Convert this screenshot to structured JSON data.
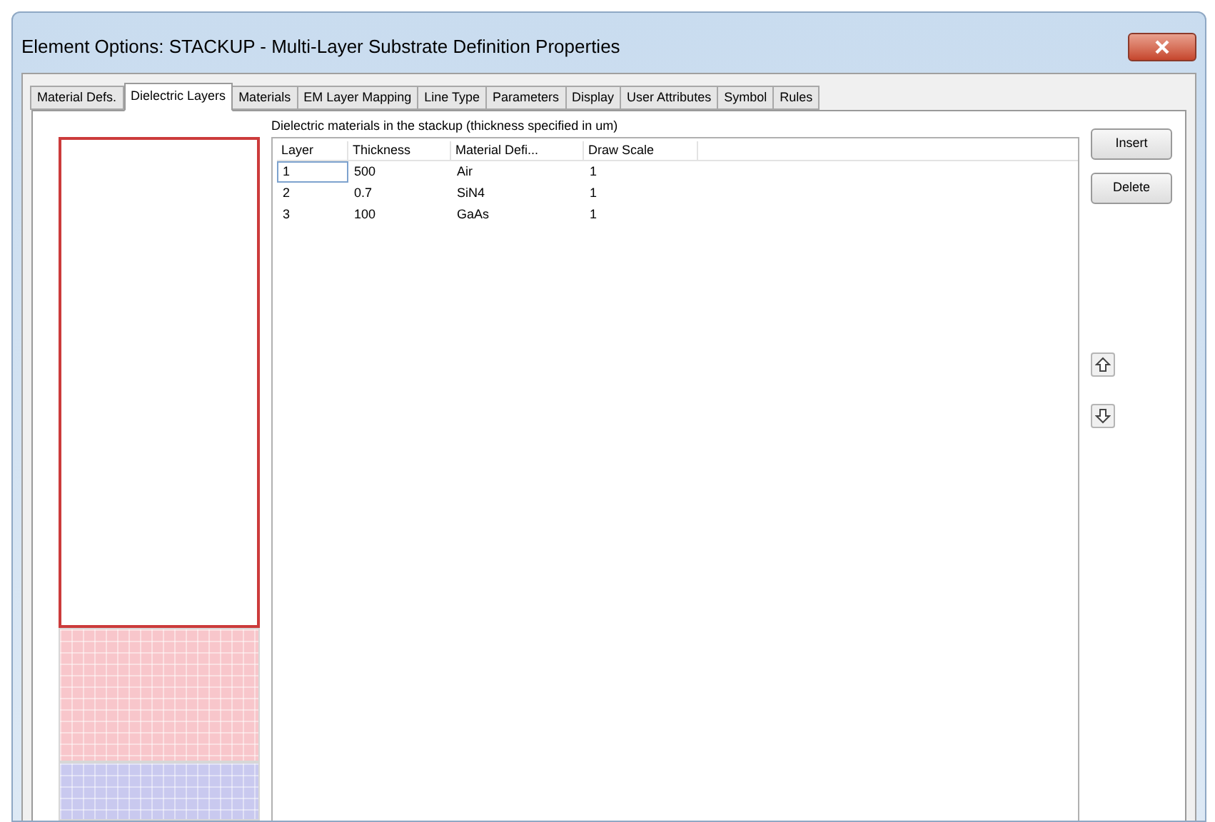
{
  "window": {
    "title": "Element Options: STACKUP - Multi-Layer Substrate Definition Properties"
  },
  "tabs": [
    {
      "label": "Material Defs.",
      "selected": false
    },
    {
      "label": "Dielectric Layers",
      "selected": true
    },
    {
      "label": "Materials",
      "selected": false
    },
    {
      "label": "EM Layer Mapping",
      "selected": false
    },
    {
      "label": "Line Type",
      "selected": false
    },
    {
      "label": "Parameters",
      "selected": false
    },
    {
      "label": "Display",
      "selected": false
    },
    {
      "label": "User Attributes",
      "selected": false
    },
    {
      "label": "Symbol",
      "selected": false
    },
    {
      "label": "Rules",
      "selected": false
    }
  ],
  "table": {
    "caption": "Dielectric materials in the stackup (thickness specified in um)",
    "columns": [
      "Layer",
      "Thickness",
      "Material Defi...",
      "Draw Scale"
    ],
    "rows": [
      {
        "cells": [
          "1",
          "500",
          "Air",
          "1"
        ],
        "selected": true,
        "color": "#ffffff"
      },
      {
        "cells": [
          "2",
          "0.7",
          "SiN4",
          "1"
        ],
        "selected": false,
        "color": "#f8c6cb"
      },
      {
        "cells": [
          "3",
          "100",
          "GaAs",
          "1"
        ],
        "selected": false,
        "color": "#c9c9ef"
      }
    ]
  },
  "buttons": [
    "Insert",
    "Delete"
  ]
}
